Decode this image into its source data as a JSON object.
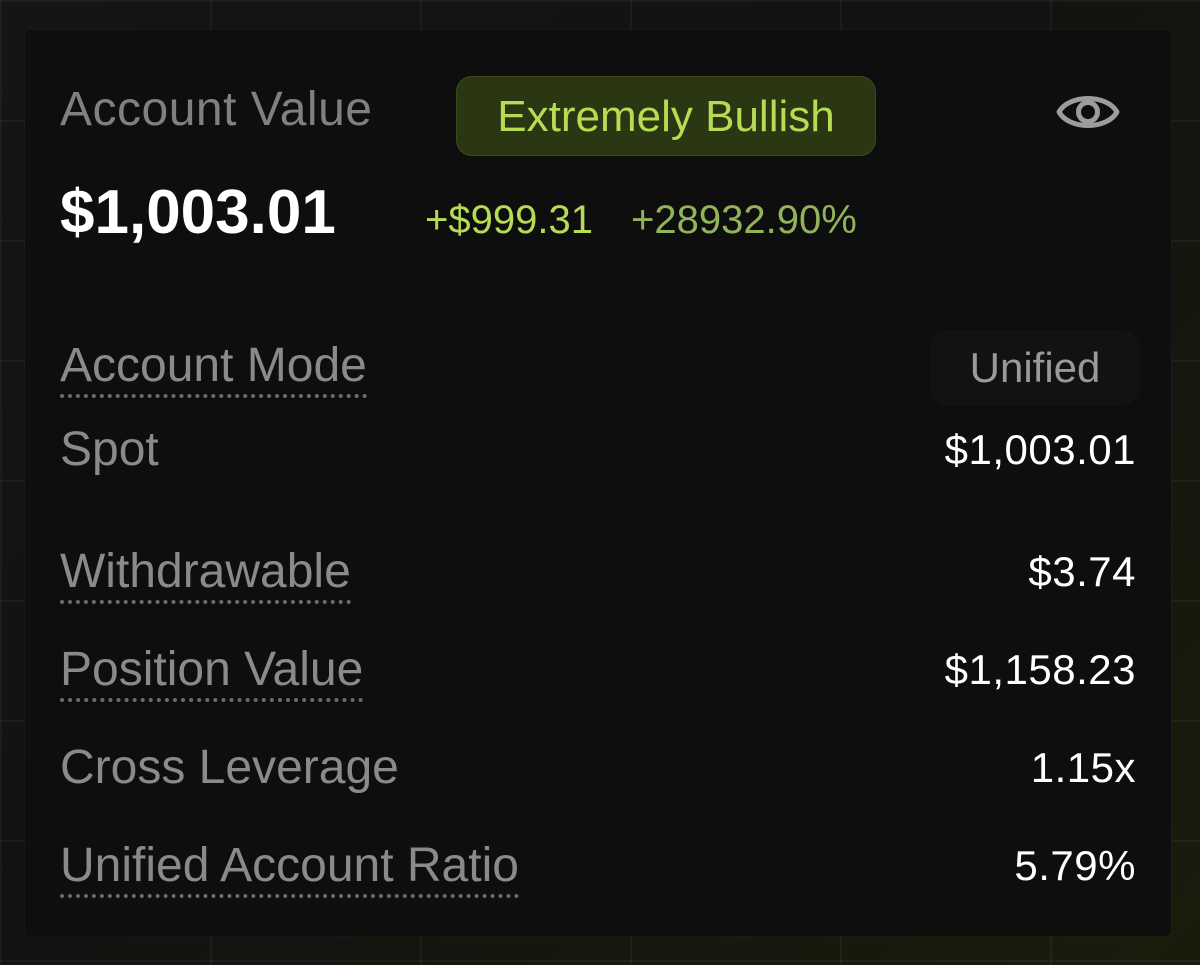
{
  "header": {
    "title": "Account Value",
    "sentiment": "Extremely Bullish",
    "visibility_icon": "eye-icon"
  },
  "summary": {
    "account_value": "$1,003.01",
    "pnl_amount": "+$999.31",
    "pnl_percent": "+28932.90%"
  },
  "rows": {
    "account_mode": {
      "label": "Account Mode",
      "value": "Unified"
    },
    "spot": {
      "label": "Spot",
      "value": "$1,003.01"
    },
    "withdrawable": {
      "label": "Withdrawable",
      "value": "$3.74"
    },
    "position_value": {
      "label": "Position Value",
      "value": "$1,158.23"
    },
    "cross_leverage": {
      "label": "Cross Leverage",
      "value": "1.15x"
    },
    "unified_account_ratio": {
      "label": "Unified Account Ratio",
      "value": "5.79%"
    }
  },
  "colors": {
    "positive": "#b5dc53",
    "positive_muted": "#91b45a",
    "badge_bg": "#2b3613",
    "card_bg": "#0e0e0f",
    "label": "#8a8a8a",
    "value": "#ffffff"
  }
}
